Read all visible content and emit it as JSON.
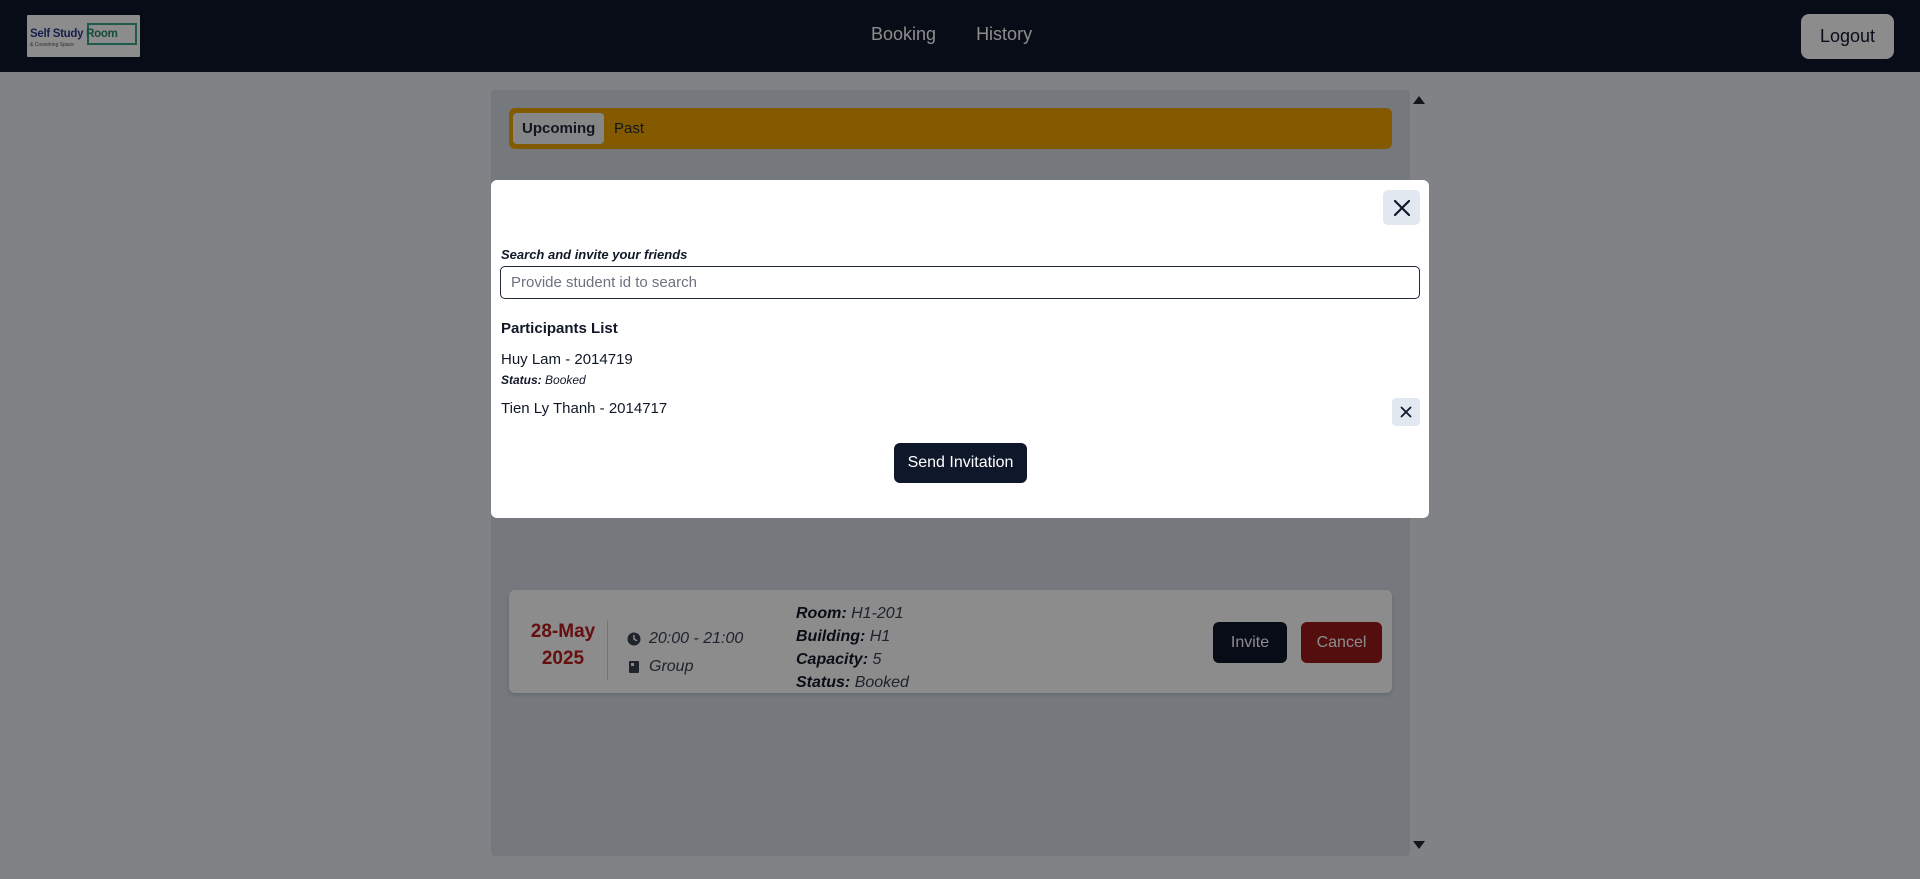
{
  "header": {
    "logo": {
      "title_part1": "Self Study ",
      "title_part2": "Room",
      "subtitle": "& Coworking Space"
    },
    "nav": [
      {
        "label": "Booking"
      },
      {
        "label": "History"
      }
    ],
    "logout_label": "Logout"
  },
  "tabs": [
    {
      "label": "Upcoming",
      "active": true
    },
    {
      "label": "Past",
      "active": false
    }
  ],
  "booking": {
    "date_day_month": "28-May",
    "date_year": "2025",
    "time": "20:00 - 21:00",
    "type": "Group",
    "room_label": "Room:",
    "room_value": "H1-201",
    "building_label": "Building:",
    "building_value": "H1",
    "capacity_label": "Capacity:",
    "capacity_value": "5",
    "status_label": "Status:",
    "status_value": "Booked",
    "invite_label": "Invite",
    "cancel_label": "Cancel"
  },
  "modal": {
    "search_label": "Search and invite your friends",
    "search_placeholder": "Provide student id to search",
    "search_value": "",
    "participants_title": "Participants List",
    "participants": [
      {
        "name": "Huy Lam - 2014719",
        "status_label": "Status:",
        "status_value": "Booked"
      },
      {
        "name": "Tien Ly Thanh - 2014717"
      }
    ],
    "send_label": "Send Invitation"
  },
  "colors": {
    "navbar": "#0f172a",
    "tabs_bar": "#f0a500",
    "date_red": "#b91c1c",
    "cancel_red": "#991b1b"
  },
  "icons": [
    "close-icon",
    "clock-icon",
    "group-icon",
    "scroll-up-arrow-icon",
    "scroll-down-arrow-icon"
  ]
}
